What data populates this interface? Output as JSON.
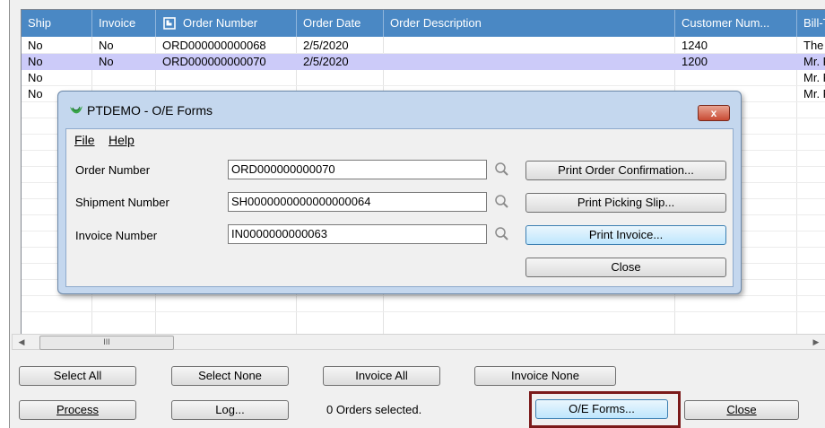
{
  "grid": {
    "columns": [
      "Ship",
      "Invoice",
      "Order Number",
      "Order Date",
      "Order Description",
      "Customer Num...",
      "Bill-To"
    ],
    "rows": [
      [
        "No",
        "No",
        "ORD000000000068",
        "2/5/2020",
        "",
        "1240",
        "The C"
      ],
      [
        "No",
        "No",
        "ORD000000000070",
        "2/5/2020",
        "",
        "1200",
        "Mr. Ro"
      ],
      [
        "No",
        "",
        "",
        "",
        "",
        "",
        "Mr. Ro"
      ],
      [
        "No",
        "",
        "",
        "",
        "",
        "",
        "Mr. Ro"
      ]
    ],
    "scroll_thumb": "III"
  },
  "buttons": {
    "select_all": "Select All",
    "select_none": "Select None",
    "invoice_all": "Invoice All",
    "invoice_none": "Invoice None",
    "process": "Process",
    "log": "Log...",
    "oe_forms": "O/E Forms...",
    "close": "Close"
  },
  "status_text": "0 Orders selected.",
  "dialog": {
    "title": "PTDEMO - O/E Forms",
    "menu": [
      "File",
      "Help"
    ],
    "fields": [
      {
        "label": "Order Number",
        "value": "ORD000000000070"
      },
      {
        "label": "Shipment Number",
        "value": "SH0000000000000000064"
      },
      {
        "label": "Invoice Number",
        "value": "IN0000000000063"
      }
    ],
    "buttons": {
      "print_order_confirmation": "Print Order Confirmation...",
      "print_picking_slip": "Print Picking Slip...",
      "print_invoice": "Print Invoice...",
      "close": "Close"
    },
    "close_glyph": "x"
  },
  "colors": {
    "header_bg": "#4a88c4",
    "selected_row": "#cccbf9",
    "highlight_border": "#7b1a1a"
  }
}
